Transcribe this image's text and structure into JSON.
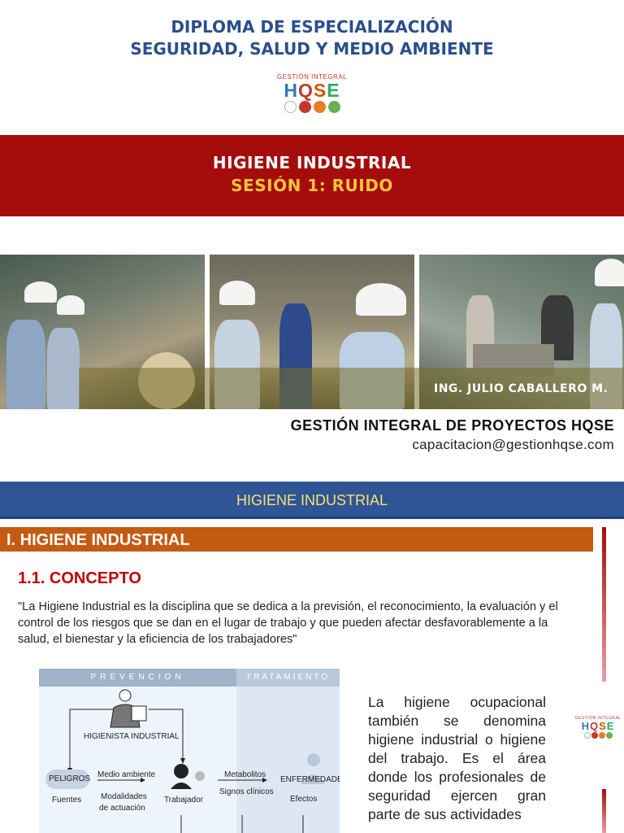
{
  "slide1": {
    "title_line1": "DIPLOMA DE ESPECIALIZACIÓN",
    "title_line2": "SEGURIDAD, SALUD Y MEDIO AMBIENTE",
    "logo": {
      "caption": "GESTIÓN INTEGRAL",
      "letters": [
        "H",
        "Q",
        "S",
        "E"
      ],
      "dot_colors": [
        "#ffffff",
        "#c0392b",
        "#e67e22",
        "#6ab04c"
      ]
    },
    "banner": {
      "line1": "HIGIENE INDUSTRIAL",
      "line2": "SESIÓN 1: RUIDO",
      "color": "#a50d0d",
      "accent": "#f5c33b"
    },
    "credit": "ING. JULIO CABALLERO M.",
    "company_name": "GESTIÓN INTEGRAL DE PROYECTOS HQSE",
    "email": "capacitacion@gestionhqse.com"
  },
  "slide2": {
    "header": "HIGIENE INDUSTRIAL",
    "section_title": "I. HIGIENE INDUSTRIAL",
    "subsection_title": "1.1. CONCEPTO",
    "quote": "\"La Higiene Industrial es la disciplina que se dedica a la previsión, el reconocimiento, la evaluación y el control de los riesgos que se dan en el lugar de trabajo y que pueden afectar desfavorablemente a la salud, el bienestar y la eficiencia de los trabajadores\"",
    "diagram": {
      "col_left": "PREVENCION",
      "col_right": "TRATAMIENTO",
      "hygienist": "HIGIENISTA INDUSTRIAL",
      "hazards": "PELIGROS",
      "sources": "Fuentes",
      "environment": "Medio ambiente",
      "modalities_1": "Modalidades",
      "modalities_2": "de actuación",
      "worker": "Trabajador",
      "metabolites": "Metabolitos",
      "signs": "Signos clínicos",
      "diseases": "ENFERMEDADES",
      "effects": "Efectos"
    },
    "paragraph": "La higiene ocupacional también se denomina higiene industrial o higiene del trabajo. Es el área donde los profesionales de seguridad ejercen gran parte de sus actividades",
    "colors": {
      "blue_bar": "#2f5597",
      "orange_bar": "#c55a11",
      "heading_red": "#c00000"
    }
  }
}
